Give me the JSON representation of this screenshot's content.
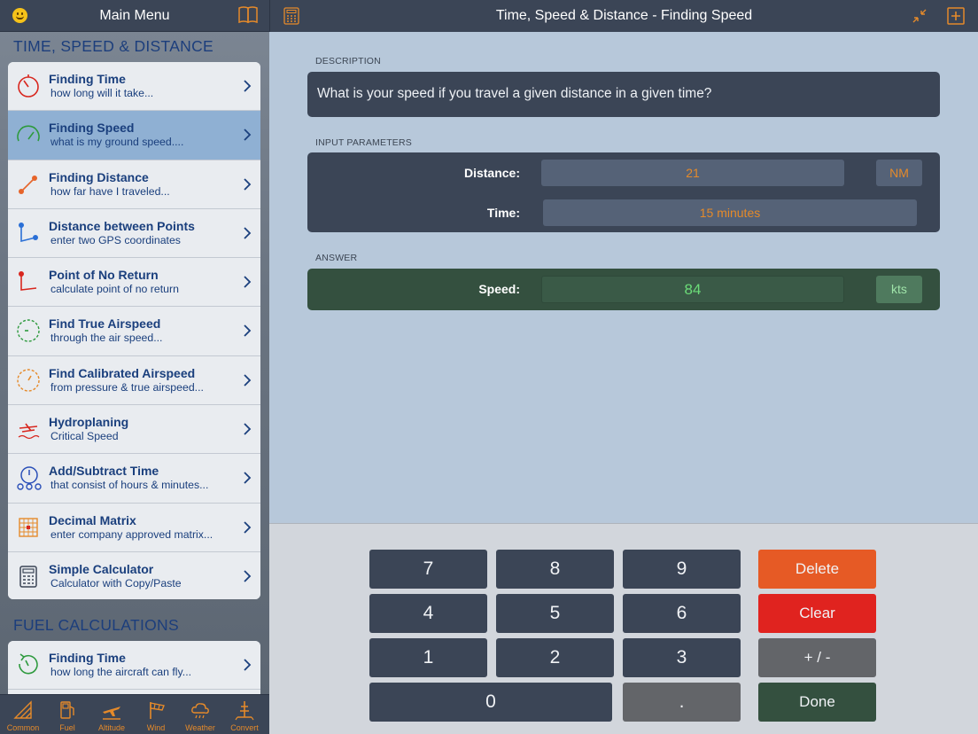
{
  "left_header": {
    "title": "Main Menu"
  },
  "sections": [
    {
      "title": "TIME, SPEED & DISTANCE",
      "items": [
        {
          "title": "Finding Time",
          "subtitle": "how long will it take...",
          "icon": "stopwatch-icon",
          "selected": false
        },
        {
          "title": "Finding Speed",
          "subtitle": "what is my ground speed....",
          "icon": "speedometer-icon",
          "selected": true
        },
        {
          "title": "Finding Distance",
          "subtitle": "how far have I traveled...",
          "icon": "distance-icon",
          "selected": false
        },
        {
          "title": "Distance between Points",
          "subtitle": "enter two GPS coordinates",
          "icon": "gps-points-icon",
          "selected": false
        },
        {
          "title": "Point of No Return",
          "subtitle": "calculate point of no return",
          "icon": "no-return-icon",
          "selected": false
        },
        {
          "title": "Find True Airspeed",
          "subtitle": "through the air speed...",
          "icon": "true-airspeed-icon",
          "selected": false
        },
        {
          "title": "Find Calibrated Airspeed",
          "subtitle": "from pressure & true airspeed...",
          "icon": "calibrated-airspeed-icon",
          "selected": false
        },
        {
          "title": "Hydroplaning",
          "subtitle": "Critical Speed",
          "icon": "hydroplaning-icon",
          "selected": false
        },
        {
          "title": "Add/Subtract Time",
          "subtitle": "that consist of hours & minutes...",
          "icon": "add-time-icon",
          "selected": false
        },
        {
          "title": "Decimal Matrix",
          "subtitle": "enter company approved matrix...",
          "icon": "matrix-icon",
          "selected": false
        },
        {
          "title": "Simple Calculator",
          "subtitle": "Calculator with Copy/Paste",
          "icon": "calculator-icon",
          "selected": false
        }
      ]
    },
    {
      "title": "FUEL CALCULATIONS",
      "items": [
        {
          "title": "Finding Time",
          "subtitle": "how long the aircraft can fly...",
          "icon": "fuel-time-icon",
          "selected": false
        }
      ]
    }
  ],
  "tabbar": [
    {
      "label": "Common",
      "icon": "common-icon"
    },
    {
      "label": "Fuel",
      "icon": "fuel-icon"
    },
    {
      "label": "Altitude",
      "icon": "altitude-icon"
    },
    {
      "label": "Wind",
      "icon": "wind-icon"
    },
    {
      "label": "Weather",
      "icon": "weather-icon"
    },
    {
      "label": "Convert",
      "icon": "convert-icon"
    }
  ],
  "right_header": {
    "title": "Time, Speed & Distance - Finding Speed"
  },
  "description": {
    "label": "DESCRIPTION",
    "text": "What is your speed if you travel a given distance in a given time?"
  },
  "inputs": {
    "label": "INPUT PARAMETERS",
    "distance": {
      "label": "Distance:",
      "value": "21",
      "unit": "NM"
    },
    "time": {
      "label": "Time:",
      "value": "15 minutes"
    }
  },
  "answer": {
    "label": "ANSWER",
    "speed": {
      "label": "Speed:",
      "value": "84",
      "unit": "kts"
    }
  },
  "keypad": {
    "k7": "7",
    "k8": "8",
    "k9": "9",
    "delete": "Delete",
    "k4": "4",
    "k5": "5",
    "k6": "6",
    "clear": "Clear",
    "k1": "1",
    "k2": "2",
    "k3": "3",
    "plusminus": "+ / -",
    "k0": "0",
    "dot": ".",
    "done": "Done"
  },
  "colors": {
    "accent": "#e58a2a",
    "header": "#3b4556",
    "menu_text": "#1a3f7d",
    "answer": "#6bdc78",
    "delete": "#e65a25",
    "clear": "#e0231f",
    "done": "#34503f"
  }
}
